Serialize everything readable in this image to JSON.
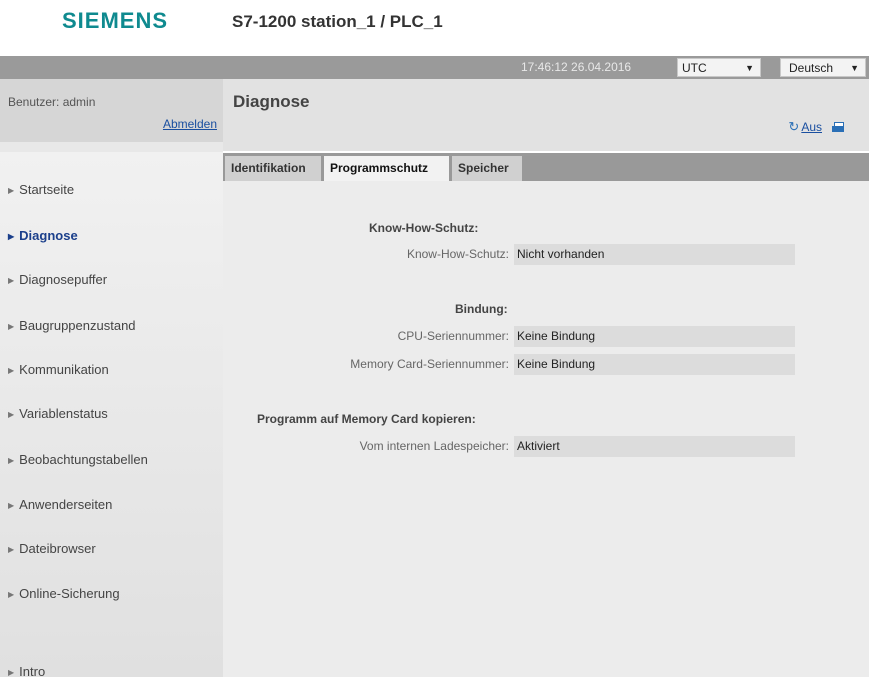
{
  "header": {
    "logo": "SIEMENS",
    "station": "S7-1200 station_1 / PLC_1"
  },
  "topbar": {
    "clock": "17:46:12  26.04.2016",
    "timezone": "UTC",
    "language": "Deutsch"
  },
  "user": {
    "label": "Benutzer: admin",
    "logout": "Abmelden"
  },
  "sidebar": {
    "items": [
      {
        "label": "Startseite"
      },
      {
        "label": "Diagnose"
      },
      {
        "label": "Diagnosepuffer"
      },
      {
        "label": "Baugruppenzustand"
      },
      {
        "label": "Kommunikation"
      },
      {
        "label": "Variablenstatus"
      },
      {
        "label": "Beobachtungstabellen"
      },
      {
        "label": "Anwenderseiten"
      },
      {
        "label": "Dateibrowser"
      },
      {
        "label": "Online-Sicherung"
      },
      {
        "label": "Intro"
      }
    ],
    "active": "Diagnose"
  },
  "page": {
    "title": "Diagnose",
    "refresh_label": "Aus",
    "icons": [
      "refresh-icon",
      "print-icon"
    ]
  },
  "tabs": [
    {
      "label": "Identifikation"
    },
    {
      "label": "Programmschutz"
    },
    {
      "label": "Speicher"
    }
  ],
  "active_tab": "Programmschutz",
  "content": {
    "know_how": {
      "title": "Know-How-Schutz:",
      "rows": [
        {
          "label": "Know-How-Schutz:",
          "value": "Nicht vorhanden"
        }
      ]
    },
    "binding": {
      "title": "Bindung:",
      "rows": [
        {
          "label": "CPU-Seriennummer:",
          "value": "Keine Bindung"
        },
        {
          "label": "Memory Card-Seriennummer:",
          "value": "Keine Bindung"
        }
      ]
    },
    "copy": {
      "title": "Programm auf Memory Card kopieren:",
      "rows": [
        {
          "label": "Vom internen Ladespeicher:",
          "value": "Aktiviert"
        }
      ]
    }
  },
  "colors": {
    "logo": "#0f8a8f",
    "link": "#1a4fa0",
    "active_nav": "#1b3f8b"
  }
}
